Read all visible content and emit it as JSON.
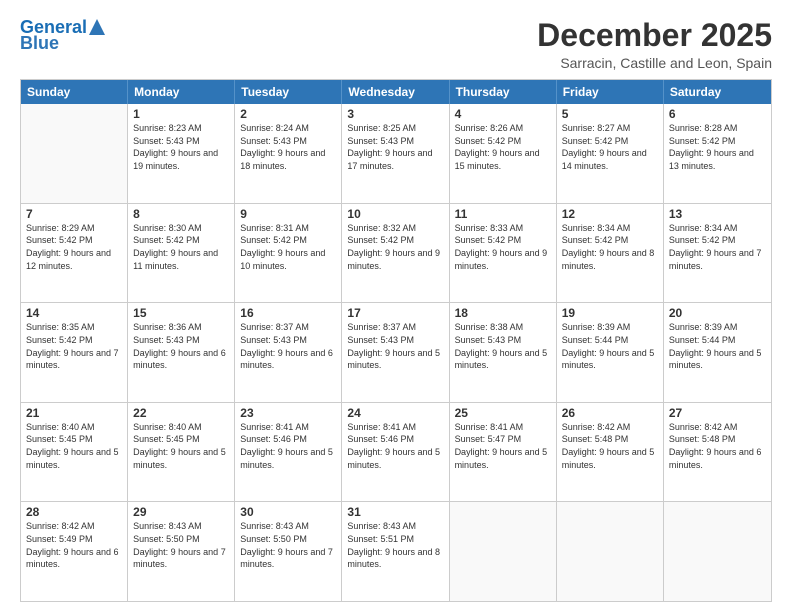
{
  "header": {
    "logo_line1": "General",
    "logo_line2": "Blue",
    "title": "December 2025",
    "location": "Sarracin, Castille and Leon, Spain"
  },
  "days_of_week": [
    "Sunday",
    "Monday",
    "Tuesday",
    "Wednesday",
    "Thursday",
    "Friday",
    "Saturday"
  ],
  "weeks": [
    [
      {
        "day": "",
        "sunrise": "",
        "sunset": "",
        "daylight": ""
      },
      {
        "day": "1",
        "sunrise": "Sunrise: 8:23 AM",
        "sunset": "Sunset: 5:43 PM",
        "daylight": "Daylight: 9 hours and 19 minutes."
      },
      {
        "day": "2",
        "sunrise": "Sunrise: 8:24 AM",
        "sunset": "Sunset: 5:43 PM",
        "daylight": "Daylight: 9 hours and 18 minutes."
      },
      {
        "day": "3",
        "sunrise": "Sunrise: 8:25 AM",
        "sunset": "Sunset: 5:43 PM",
        "daylight": "Daylight: 9 hours and 17 minutes."
      },
      {
        "day": "4",
        "sunrise": "Sunrise: 8:26 AM",
        "sunset": "Sunset: 5:42 PM",
        "daylight": "Daylight: 9 hours and 15 minutes."
      },
      {
        "day": "5",
        "sunrise": "Sunrise: 8:27 AM",
        "sunset": "Sunset: 5:42 PM",
        "daylight": "Daylight: 9 hours and 14 minutes."
      },
      {
        "day": "6",
        "sunrise": "Sunrise: 8:28 AM",
        "sunset": "Sunset: 5:42 PM",
        "daylight": "Daylight: 9 hours and 13 minutes."
      }
    ],
    [
      {
        "day": "7",
        "sunrise": "Sunrise: 8:29 AM",
        "sunset": "Sunset: 5:42 PM",
        "daylight": "Daylight: 9 hours and 12 minutes."
      },
      {
        "day": "8",
        "sunrise": "Sunrise: 8:30 AM",
        "sunset": "Sunset: 5:42 PM",
        "daylight": "Daylight: 9 hours and 11 minutes."
      },
      {
        "day": "9",
        "sunrise": "Sunrise: 8:31 AM",
        "sunset": "Sunset: 5:42 PM",
        "daylight": "Daylight: 9 hours and 10 minutes."
      },
      {
        "day": "10",
        "sunrise": "Sunrise: 8:32 AM",
        "sunset": "Sunset: 5:42 PM",
        "daylight": "Daylight: 9 hours and 9 minutes."
      },
      {
        "day": "11",
        "sunrise": "Sunrise: 8:33 AM",
        "sunset": "Sunset: 5:42 PM",
        "daylight": "Daylight: 9 hours and 9 minutes."
      },
      {
        "day": "12",
        "sunrise": "Sunrise: 8:34 AM",
        "sunset": "Sunset: 5:42 PM",
        "daylight": "Daylight: 9 hours and 8 minutes."
      },
      {
        "day": "13",
        "sunrise": "Sunrise: 8:34 AM",
        "sunset": "Sunset: 5:42 PM",
        "daylight": "Daylight: 9 hours and 7 minutes."
      }
    ],
    [
      {
        "day": "14",
        "sunrise": "Sunrise: 8:35 AM",
        "sunset": "Sunset: 5:42 PM",
        "daylight": "Daylight: 9 hours and 7 minutes."
      },
      {
        "day": "15",
        "sunrise": "Sunrise: 8:36 AM",
        "sunset": "Sunset: 5:43 PM",
        "daylight": "Daylight: 9 hours and 6 minutes."
      },
      {
        "day": "16",
        "sunrise": "Sunrise: 8:37 AM",
        "sunset": "Sunset: 5:43 PM",
        "daylight": "Daylight: 9 hours and 6 minutes."
      },
      {
        "day": "17",
        "sunrise": "Sunrise: 8:37 AM",
        "sunset": "Sunset: 5:43 PM",
        "daylight": "Daylight: 9 hours and 5 minutes."
      },
      {
        "day": "18",
        "sunrise": "Sunrise: 8:38 AM",
        "sunset": "Sunset: 5:43 PM",
        "daylight": "Daylight: 9 hours and 5 minutes."
      },
      {
        "day": "19",
        "sunrise": "Sunrise: 8:39 AM",
        "sunset": "Sunset: 5:44 PM",
        "daylight": "Daylight: 9 hours and 5 minutes."
      },
      {
        "day": "20",
        "sunrise": "Sunrise: 8:39 AM",
        "sunset": "Sunset: 5:44 PM",
        "daylight": "Daylight: 9 hours and 5 minutes."
      }
    ],
    [
      {
        "day": "21",
        "sunrise": "Sunrise: 8:40 AM",
        "sunset": "Sunset: 5:45 PM",
        "daylight": "Daylight: 9 hours and 5 minutes."
      },
      {
        "day": "22",
        "sunrise": "Sunrise: 8:40 AM",
        "sunset": "Sunset: 5:45 PM",
        "daylight": "Daylight: 9 hours and 5 minutes."
      },
      {
        "day": "23",
        "sunrise": "Sunrise: 8:41 AM",
        "sunset": "Sunset: 5:46 PM",
        "daylight": "Daylight: 9 hours and 5 minutes."
      },
      {
        "day": "24",
        "sunrise": "Sunrise: 8:41 AM",
        "sunset": "Sunset: 5:46 PM",
        "daylight": "Daylight: 9 hours and 5 minutes."
      },
      {
        "day": "25",
        "sunrise": "Sunrise: 8:41 AM",
        "sunset": "Sunset: 5:47 PM",
        "daylight": "Daylight: 9 hours and 5 minutes."
      },
      {
        "day": "26",
        "sunrise": "Sunrise: 8:42 AM",
        "sunset": "Sunset: 5:48 PM",
        "daylight": "Daylight: 9 hours and 5 minutes."
      },
      {
        "day": "27",
        "sunrise": "Sunrise: 8:42 AM",
        "sunset": "Sunset: 5:48 PM",
        "daylight": "Daylight: 9 hours and 6 minutes."
      }
    ],
    [
      {
        "day": "28",
        "sunrise": "Sunrise: 8:42 AM",
        "sunset": "Sunset: 5:49 PM",
        "daylight": "Daylight: 9 hours and 6 minutes."
      },
      {
        "day": "29",
        "sunrise": "Sunrise: 8:43 AM",
        "sunset": "Sunset: 5:50 PM",
        "daylight": "Daylight: 9 hours and 7 minutes."
      },
      {
        "day": "30",
        "sunrise": "Sunrise: 8:43 AM",
        "sunset": "Sunset: 5:50 PM",
        "daylight": "Daylight: 9 hours and 7 minutes."
      },
      {
        "day": "31",
        "sunrise": "Sunrise: 8:43 AM",
        "sunset": "Sunset: 5:51 PM",
        "daylight": "Daylight: 9 hours and 8 minutes."
      },
      {
        "day": "",
        "sunrise": "",
        "sunset": "",
        "daylight": ""
      },
      {
        "day": "",
        "sunrise": "",
        "sunset": "",
        "daylight": ""
      },
      {
        "day": "",
        "sunrise": "",
        "sunset": "",
        "daylight": ""
      }
    ]
  ]
}
